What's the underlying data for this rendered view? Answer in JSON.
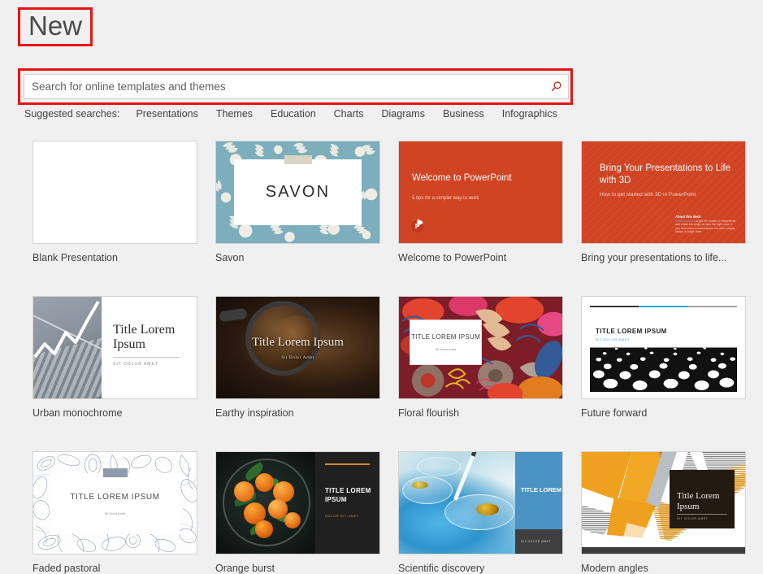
{
  "page": {
    "title": "New"
  },
  "search": {
    "placeholder": "Search for online templates and themes",
    "value": "",
    "icon": "search-icon"
  },
  "suggested": {
    "label": "Suggested searches:",
    "items": [
      "Presentations",
      "Themes",
      "Education",
      "Charts",
      "Diagrams",
      "Business",
      "Infographics"
    ]
  },
  "colors": {
    "background": "#f0f0f0",
    "highlight_outline": "#e81313",
    "accent_orange": "#d04423",
    "savon_teal": "#7caebd",
    "savon_cream": "#efede3",
    "text": "#3f3f3f"
  },
  "templates": [
    {
      "label": "Blank Presentation",
      "preview": {
        "kind": "blank"
      }
    },
    {
      "label": "Savon",
      "preview": {
        "kind": "savon",
        "title": "SAVON"
      }
    },
    {
      "label": "Welcome to PowerPoint",
      "preview": {
        "kind": "welcome",
        "title": "Welcome to PowerPoint",
        "subtitle": "5 tips for a simpler way to work",
        "badge": "P"
      }
    },
    {
      "label": "Bring your presentations to life...",
      "preview": {
        "kind": "life3d",
        "title": "Bring Your Presentations to Life with 3D",
        "subtitle": "How to get started with 3D in PowerPoint",
        "note_heading": "About this deck",
        "note_link": "Select a model",
        "note_body": "to get 3D models in documents and rotate the angle to view the right view. If you don't have a subscription, the deck simply shows a single view."
      }
    },
    {
      "label": "Urban monochrome",
      "preview": {
        "kind": "urban",
        "title": "Title Lorem Ipsum",
        "subtitle": "SIT DOLOR AMET"
      }
    },
    {
      "label": "Earthy inspiration",
      "preview": {
        "kind": "earthy",
        "title": "Title Lorem Ipsum",
        "subtitle": "Sit Dolor Amet"
      }
    },
    {
      "label": "Floral flourish",
      "preview": {
        "kind": "floral",
        "title": "TITLE LOREM IPSUM",
        "subtitle": "Sit Dolor Amet"
      }
    },
    {
      "label": "Future forward",
      "preview": {
        "kind": "future",
        "title": "TITLE LOREM IPSUM",
        "subtitle": "SIT DOLOR AMET",
        "bar_colors": [
          "#3a3a3a",
          "#28a8e0",
          "#a6a6a6"
        ]
      }
    },
    {
      "label": "Faded pastoral",
      "preview": {
        "kind": "faded",
        "title": "TITLE LOREM IPSUM",
        "subtitle": "Sit Dolor Amet"
      }
    },
    {
      "label": "Orange burst",
      "preview": {
        "kind": "orangeburst",
        "title": "TITLE LOREM IPSUM",
        "subtitle": "DOLOR SIT AMET"
      }
    },
    {
      "label": "Scientific discovery",
      "preview": {
        "kind": "scientific",
        "title": "TITLE LOREM IPSUM",
        "subtitle": "SIT DOLOR AMET"
      }
    },
    {
      "label": "Modern angles",
      "preview": {
        "kind": "modern",
        "title": "Title Lorem Ipsum",
        "subtitle": "SIT DOLOR AMET"
      }
    }
  ]
}
